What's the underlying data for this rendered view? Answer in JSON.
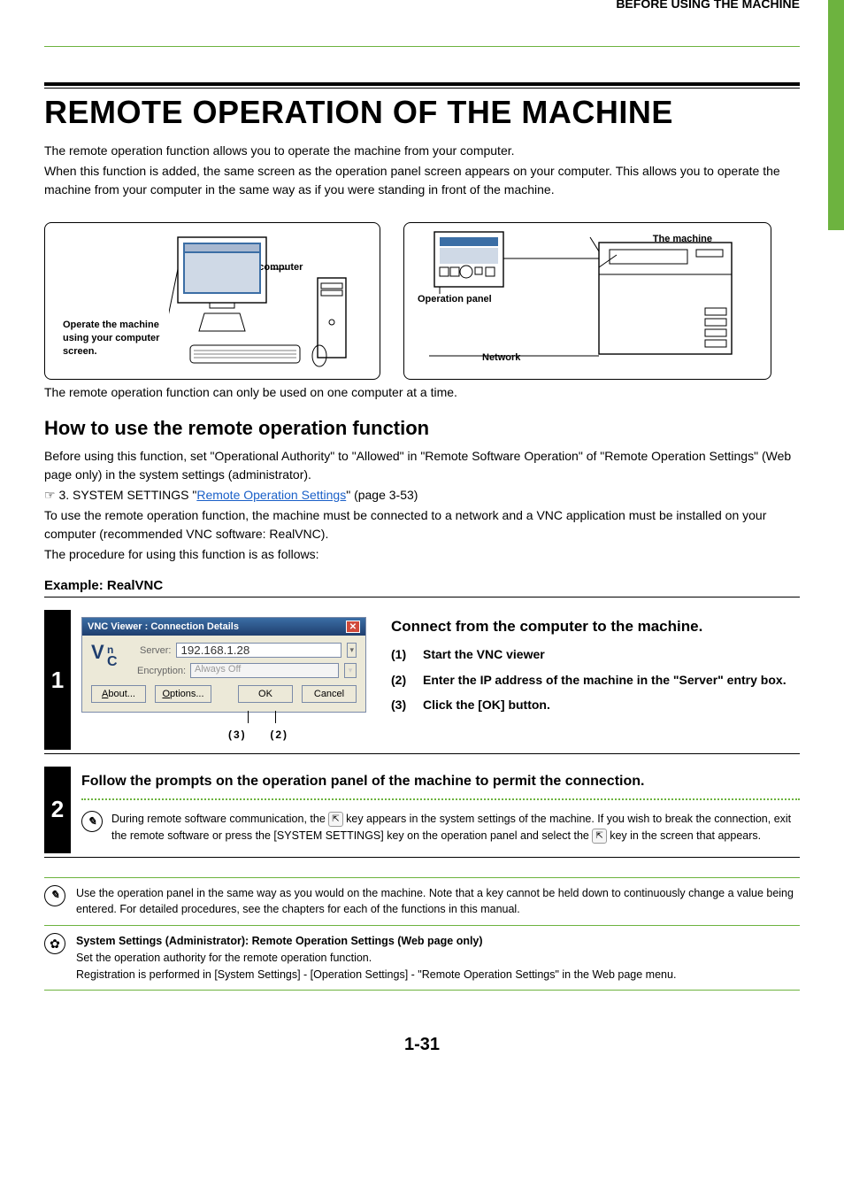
{
  "breadcrumb": "BEFORE USING THE MACHINE",
  "title": "REMOTE OPERATION OF THE MACHINE",
  "intro1": "The remote operation function allows you to operate the machine from your computer.",
  "intro2": "When this function is added, the same screen as the operation panel screen appears on your computer. This allows you to operate the machine from your computer in the same way as if you were standing in front of the machine.",
  "diagram": {
    "your_computer": "Your computer",
    "operate_msg": "Operate the machine using your computer screen.",
    "the_machine": "The machine",
    "operation_panel": "Operation panel",
    "network": "Network"
  },
  "note_under_diagram": "The remote operation function can only be used on one computer at a time.",
  "subhead": "How to use the remote operation function",
  "body_p1": "Before using this function, set \"Operational Authority\" to \"Allowed\" in \"Remote Software Operation\" of \"Remote Operation Settings\" (Web page only) in the system settings (administrator).",
  "body_p2_prefix": "☞ 3. SYSTEM SETTINGS \"",
  "body_p2_link": "Remote Operation Settings",
  "body_p2_suffix": "\" (page 3-53)",
  "body_p3": "To use the remote operation function, the machine must be connected to a network and a VNC application must be installed on your computer (recommended VNC software: RealVNC).",
  "body_p4": "The procedure for using this function is as follows:",
  "example_h": "Example: RealVNC",
  "step1": {
    "num": "1",
    "dlg_title": "VNC Viewer : Connection Details",
    "logo_top": "V",
    "logo_rest": "C",
    "server_label": "Server:",
    "server_value": "192.168.1.28",
    "enc_label": "Encryption:",
    "enc_value": "Always Off",
    "btn_about": "About...",
    "btn_options": "Options...",
    "btn_ok": "OK",
    "btn_cancel": "Cancel",
    "callout_3": "(3)",
    "callout_2": "(2)",
    "connect_h": "Connect from the computer to the machine.",
    "s1n": "(1)",
    "s1t": "Start the VNC viewer",
    "s2n": "(2)",
    "s2t": "Enter the IP address of the machine in the \"Server\" entry box.",
    "s3n": "(3)",
    "s3t": "Click the [OK] button."
  },
  "step2": {
    "num": "2",
    "heading": "Follow the prompts on the operation panel of the machine to permit the connection.",
    "body_a": "During remote software communication, the ",
    "body_b": " key appears in the system settings of the machine. If you wish to break the connection, exit the remote software or press the [SYSTEM SETTINGS] key on the operation panel and select the ",
    "body_c": " key in the screen that appears."
  },
  "info1": "Use the operation panel in the same way as you would on the machine. Note that a key cannot be held down to continuously change a value being entered. For detailed procedures, see the chapters for each of the functions in this manual.",
  "info2_h": "System Settings (Administrator): Remote Operation Settings (Web page only)",
  "info2_l1": "Set the operation authority for the remote operation function.",
  "info2_l2": "Registration is performed in [System Settings] - [Operation Settings] - \"Remote Operation Settings\" in the Web page menu.",
  "page_num": "1-31"
}
